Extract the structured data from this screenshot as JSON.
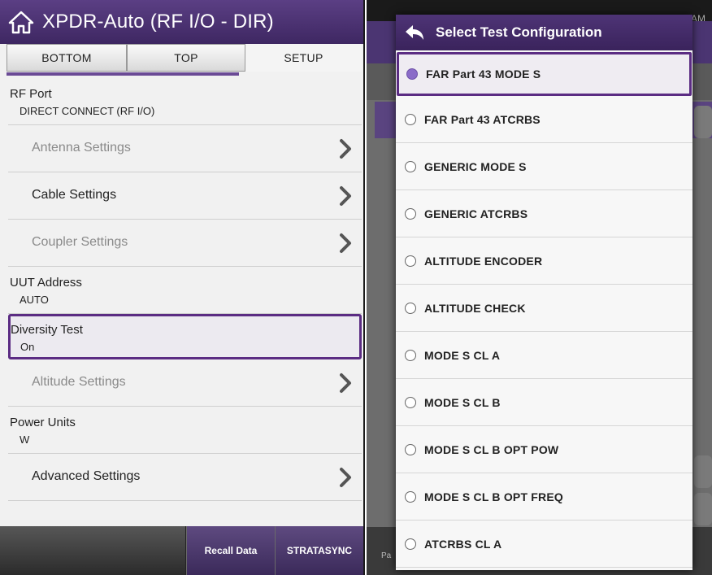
{
  "left": {
    "title": "XPDR-Auto (RF I/O - DIR)",
    "tabs": [
      "BOTTOM",
      "TOP",
      "SETUP"
    ],
    "rows": [
      {
        "label": "RF Port",
        "value": "DIRECT CONNECT (RF I/O)"
      },
      {
        "label": "Antenna Settings"
      },
      {
        "label": "Cable Settings"
      },
      {
        "label": "Coupler Settings"
      },
      {
        "label": "UUT Address",
        "value": "AUTO"
      },
      {
        "label": "Diversity Test",
        "value": "On"
      },
      {
        "label": "Altitude Settings"
      },
      {
        "label": "Power Units",
        "value": "W"
      },
      {
        "label": "Advanced Settings"
      }
    ],
    "bottom_buttons": [
      "Recall Data",
      "STRATASYNC"
    ]
  },
  "right": {
    "background_status_time_fragment": "AM",
    "background_bottom_fragment": "Pa",
    "dialog": {
      "title": "Select Test Configuration",
      "selected_index": 0,
      "options": [
        "FAR Part 43 MODE S",
        "FAR Part 43 ATCRBS",
        "GENERIC MODE S",
        "GENERIC ATCRBS",
        "ALTITUDE ENCODER",
        "ALTITUDE CHECK",
        "MODE S CL A",
        "MODE S CL B",
        "MODE S CL B OPT POW",
        "MODE S CL B OPT FREQ",
        "ATCRBS CL A"
      ]
    }
  },
  "colors": {
    "accent_purple": "#5b2c83",
    "titlebar_purple": "#4e3476",
    "radio_selected": "#8a6bc8"
  },
  "icons": [
    "home-icon",
    "chevron-right-icon",
    "back-arrow-icon"
  ]
}
